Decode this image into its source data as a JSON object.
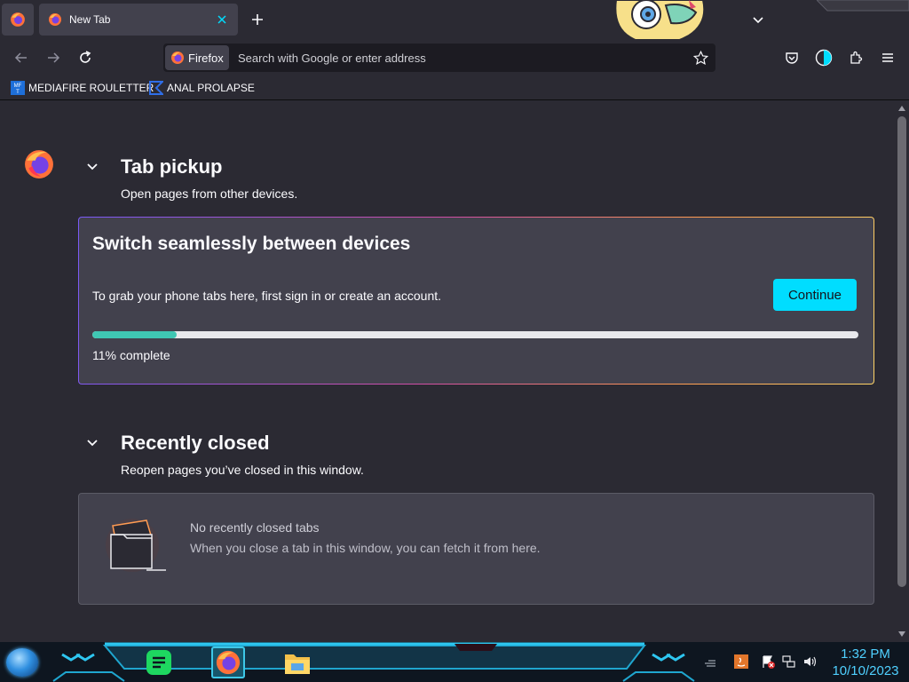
{
  "tabs": [
    {
      "title": "New Tab"
    }
  ],
  "urlbar": {
    "identity_label": "Firefox",
    "placeholder": "Search with Google or enter address"
  },
  "bookmarks": [
    {
      "label": "MEDIAFIRE ROULETTER",
      "icon": "mediafire-icon"
    },
    {
      "label": "ANAL PROLAPSE",
      "icon": "bookmark-logo-icon"
    }
  ],
  "tab_pickup": {
    "title": "Tab pickup",
    "subtitle": "Open pages from other devices.",
    "promo_title": "Switch seamlessly between devices",
    "promo_text": "To grab your phone tabs here, first sign in or create an account.",
    "button_label": "Continue",
    "progress_percent": 11,
    "progress_label": "11% complete"
  },
  "recently_closed": {
    "title": "Recently closed",
    "subtitle": "Reopen pages you’ve closed in this window.",
    "empty_title": "No recently closed tabs",
    "empty_text": "When you close a tab in this window, you can fetch it from here."
  },
  "taskbar": {
    "apps": [
      "spotify-icon",
      "firefox-icon",
      "file-explorer-icon"
    ],
    "time": "1:32 PM",
    "date": "10/10/2023"
  },
  "colors": {
    "accent": "#00ddff",
    "progress": "#3fc6b3",
    "clock": "#4fd0ff"
  }
}
